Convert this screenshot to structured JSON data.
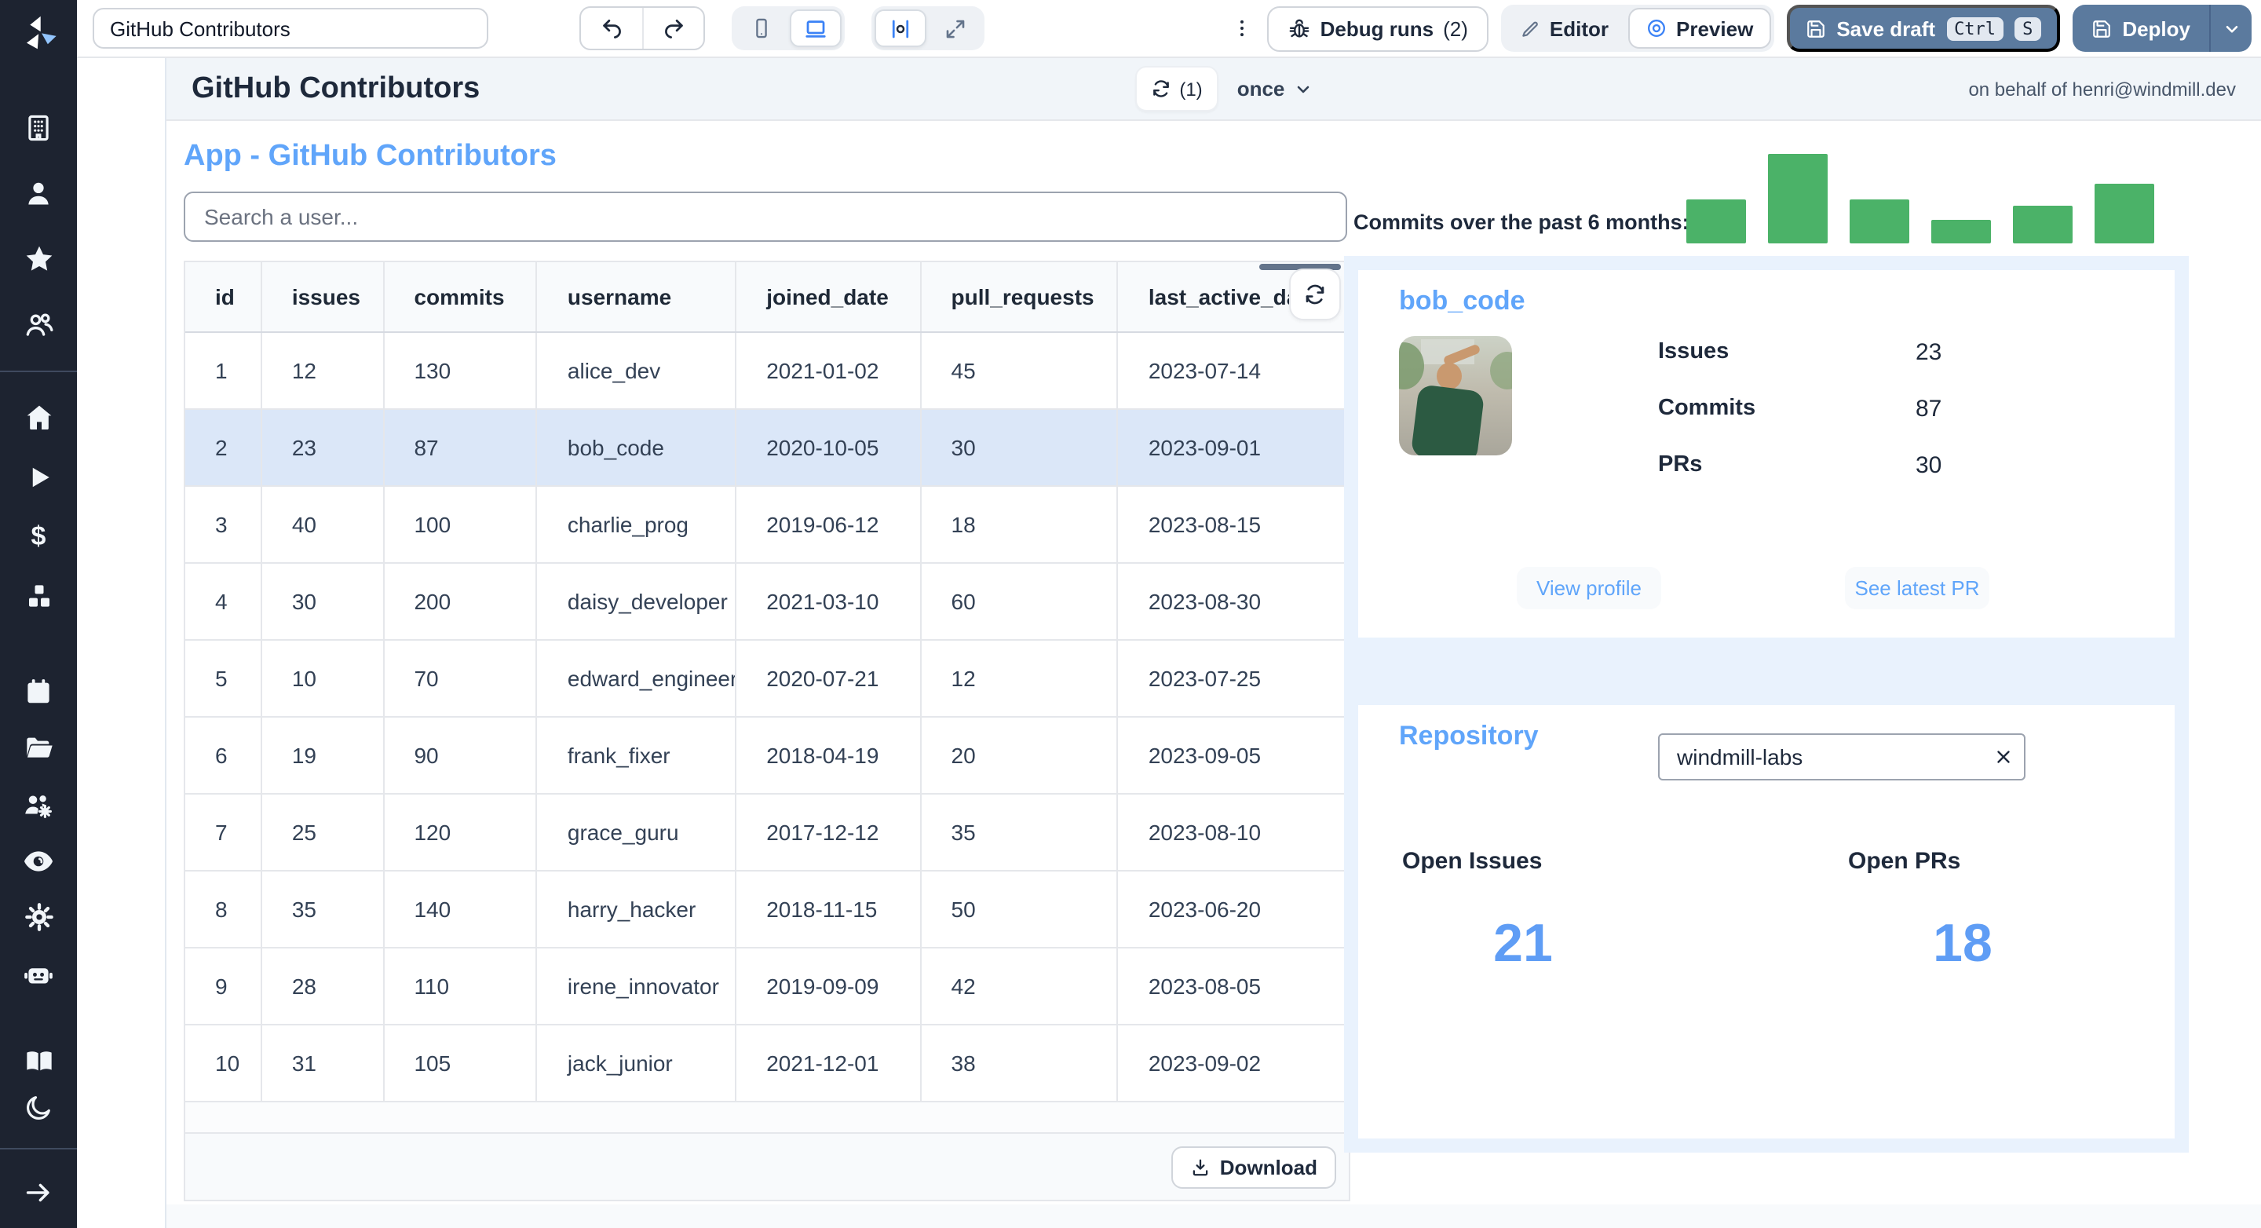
{
  "toolbar": {
    "app_name_input": "GitHub Contributors",
    "debug_runs_label": "Debug runs",
    "debug_runs_count": "(2)",
    "editor_label": "Editor",
    "preview_label": "Preview",
    "save_draft_label": "Save draft",
    "shortcut_keys": [
      "Ctrl",
      "S"
    ],
    "deploy_label": "Deploy"
  },
  "header": {
    "title": "GitHub Contributors",
    "refresh_count": "(1)",
    "schedule_label": "once",
    "on_behalf_of": "on behalf of henri@windmill.dev"
  },
  "app": {
    "title": "App - GitHub Contributors",
    "search_placeholder": "Search a user...",
    "table": {
      "columns": [
        "id",
        "issues",
        "commits",
        "username",
        "joined_date",
        "pull_requests",
        "last_active_date"
      ],
      "rows": [
        [
          "1",
          "12",
          "130",
          "alice_dev",
          "2021-01-02",
          "45",
          "2023-07-14"
        ],
        [
          "2",
          "23",
          "87",
          "bob_code",
          "2020-10-05",
          "30",
          "2023-09-01"
        ],
        [
          "3",
          "40",
          "100",
          "charlie_prog",
          "2019-06-12",
          "18",
          "2023-08-15"
        ],
        [
          "4",
          "30",
          "200",
          "daisy_developer",
          "2021-03-10",
          "60",
          "2023-08-30"
        ],
        [
          "5",
          "10",
          "70",
          "edward_engineer",
          "2020-07-21",
          "12",
          "2023-07-25"
        ],
        [
          "6",
          "19",
          "90",
          "frank_fixer",
          "2018-04-19",
          "20",
          "2023-09-05"
        ],
        [
          "7",
          "25",
          "120",
          "grace_guru",
          "2017-12-12",
          "35",
          "2023-08-10"
        ],
        [
          "8",
          "35",
          "140",
          "harry_hacker",
          "2018-11-15",
          "50",
          "2023-06-20"
        ],
        [
          "9",
          "28",
          "110",
          "irene_innovator",
          "2019-09-09",
          "42",
          "2023-08-05"
        ],
        [
          "10",
          "31",
          "105",
          "jack_junior",
          "2021-12-01",
          "38",
          "2023-09-02"
        ]
      ],
      "selected_row_id": "2",
      "download_label": "Download"
    },
    "chart": {
      "type": "bar",
      "label": "Commits over the past 6 months:",
      "values": [
        49,
        100,
        49,
        26,
        42,
        66
      ],
      "max": 100,
      "bar_color": "#4bb268"
    },
    "user_card": {
      "title": "bob_code",
      "stats": [
        {
          "label": "Issues",
          "value": "23"
        },
        {
          "label": "Commits",
          "value": "87"
        },
        {
          "label": "PRs",
          "value": "30"
        }
      ],
      "view_profile_label": "View profile",
      "see_latest_pr_label": "See latest PR"
    },
    "repo_card": {
      "title": "Repository",
      "input_value": "windmill-labs",
      "metrics": [
        {
          "label": "Open Issues",
          "value": "21"
        },
        {
          "label": "Open PRs",
          "value": "18"
        }
      ]
    }
  },
  "colors": {
    "accent_blue": "#60a5fa",
    "bar_green": "#4bb268",
    "button_slate": "#5b7a9e",
    "selected_row": "#dbe7f8",
    "sidebar_bg": "#1d2330"
  }
}
